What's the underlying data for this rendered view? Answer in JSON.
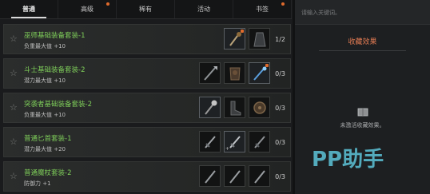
{
  "tabs": [
    {
      "label": "普通",
      "active": true
    },
    {
      "label": "高级"
    },
    {
      "label": "稀有"
    },
    {
      "label": "活动"
    },
    {
      "label": "书签"
    }
  ],
  "search": {
    "placeholder": "请输入关键词。"
  },
  "panel": {
    "title": "收藏效果",
    "empty_text": "未激活收藏效果。"
  },
  "watermark": {
    "text": "PP助手"
  },
  "sets": [
    {
      "name": "巫师基础装备套装-1",
      "attr": "负重最大值 +10",
      "count": "1/2"
    },
    {
      "name": "斗士基础装备套装-2",
      "attr": "潜力最大值 +10",
      "count": "0/3"
    },
    {
      "name": "突袭者基础装备套装-2",
      "attr": "负重最大值 +10",
      "count": "0/3"
    },
    {
      "name": "普通匕首套装-1",
      "attr": "潜力最大值 +20",
      "count": "0/3"
    },
    {
      "name": "普通魔杖套装-2",
      "attr": "防御力 +1",
      "count": "0/3"
    }
  ],
  "colors": {
    "accent": "#e06b2c",
    "set_name": "#7fcf5a",
    "panel_title": "#e07a52"
  },
  "icons": {
    "star": "star-icon",
    "empty": "book-icon"
  }
}
